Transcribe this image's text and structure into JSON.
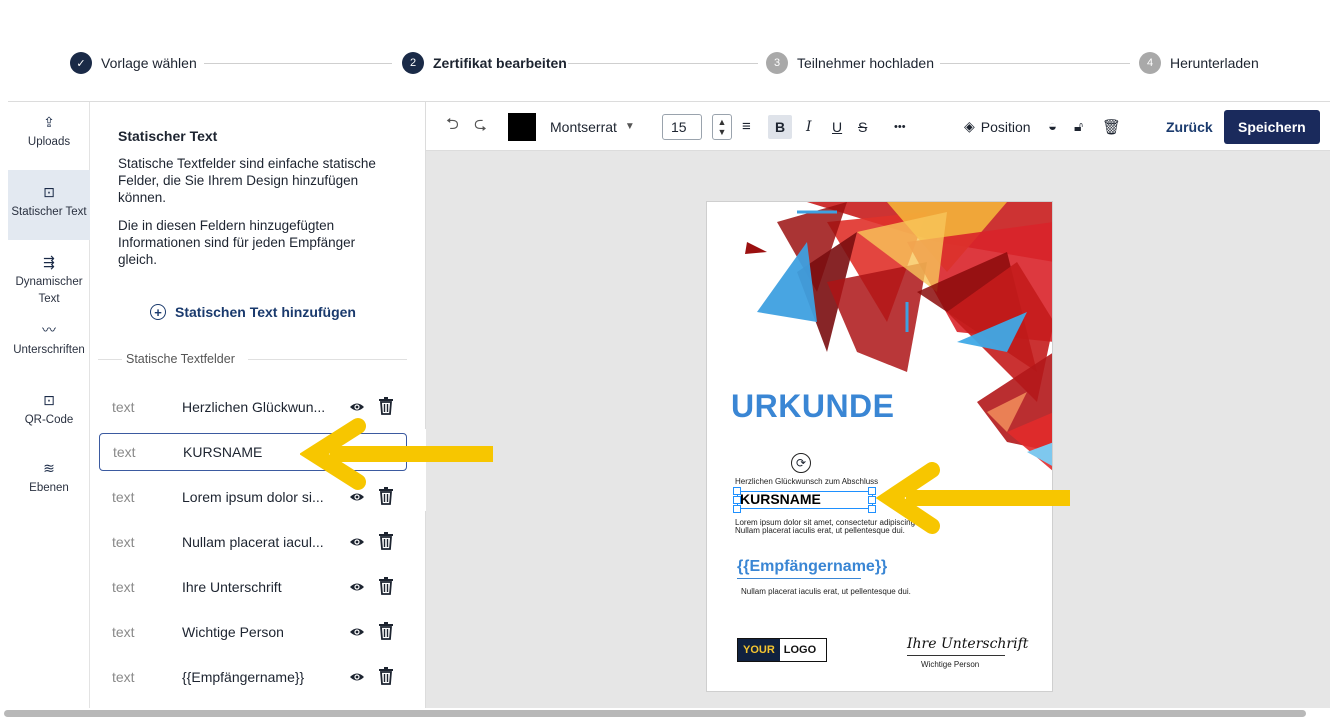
{
  "stepper": {
    "steps": [
      {
        "label": "Vorlage wählen",
        "badge": "✓",
        "state": "done"
      },
      {
        "label": "Zertifikat bearbeiten",
        "badge": "2",
        "state": "active"
      },
      {
        "label": "Teilnehmer hochladen",
        "badge": "3",
        "state": "todo"
      },
      {
        "label": "Herunterladen",
        "badge": "4",
        "state": "todo"
      }
    ]
  },
  "nav": {
    "items": [
      {
        "label": "Uploads",
        "icon": "upload-icon",
        "glyph": "⇪"
      },
      {
        "label": "Statischer Text",
        "icon": "static-text-icon",
        "glyph": "⊡"
      },
      {
        "label": "Dynamischer Text",
        "icon": "dynamic-text-icon",
        "glyph": "⇶"
      },
      {
        "label": "Unterschriften",
        "icon": "signature-icon",
        "glyph": "〰"
      },
      {
        "label": "QR-Code",
        "icon": "qr-code-icon",
        "glyph": "⊡"
      },
      {
        "label": "Ebenen",
        "icon": "layers-icon",
        "glyph": "≋"
      }
    ]
  },
  "panel": {
    "title": "Statischer Text",
    "desc1": "Statische Textfelder sind einfache statische Felder, die Sie Ihrem Design hinzufügen können.",
    "desc2": "Die in diesen Feldern hinzugefügten Informationen sind für jeden Empfänger gleich.",
    "add_label": "Statischen Text hinzufügen",
    "section_label": "Statische Textfelder",
    "rows": [
      {
        "type": "text",
        "name": "Herzlichen Glückwun..."
      },
      {
        "type": "text",
        "name": "KURSNAME"
      },
      {
        "type": "text",
        "name": "Lorem ipsum dolor si..."
      },
      {
        "type": "text",
        "name": "Nullam placerat iacul..."
      },
      {
        "type": "text",
        "name": "Ihre Unterschrift"
      },
      {
        "type": "text",
        "name": "Wichtige Person"
      },
      {
        "type": "text",
        "name": "{{Empfängername}}"
      }
    ]
  },
  "toolbar": {
    "font": "Montserrat",
    "font_size": "15",
    "text_color": "#000000",
    "bold": "B",
    "italic": "I",
    "underline": "U",
    "strike": "S",
    "more": "•••",
    "position_label": "Position",
    "back_label": "Zurück",
    "save_label": "Speichern"
  },
  "certificate": {
    "title": "URKUNDE",
    "congrats": "Herzlichen Glückwunsch zum Abschluss",
    "course": "KURSNAME",
    "lorem1": "Lorem ipsum dolor sit amet, consectetur adipiscing elit.",
    "lorem2": "Nullam placerat iaculis erat, ut pellentesque dui.",
    "recipient": "{{Empfängername}}",
    "lorem3": "Nullam placerat iaculis erat, ut pellentesque dui.",
    "logo_your": "YOUR",
    "logo_logo": "LOGO",
    "signature": "Ihre Unterschrift",
    "signer": "Wichtige Person"
  },
  "colors": {
    "primary": "#1a2a5c",
    "accent_blue": "#3a86d4",
    "arrow_yellow": "#f7c600",
    "selection": "#1e90ff"
  }
}
